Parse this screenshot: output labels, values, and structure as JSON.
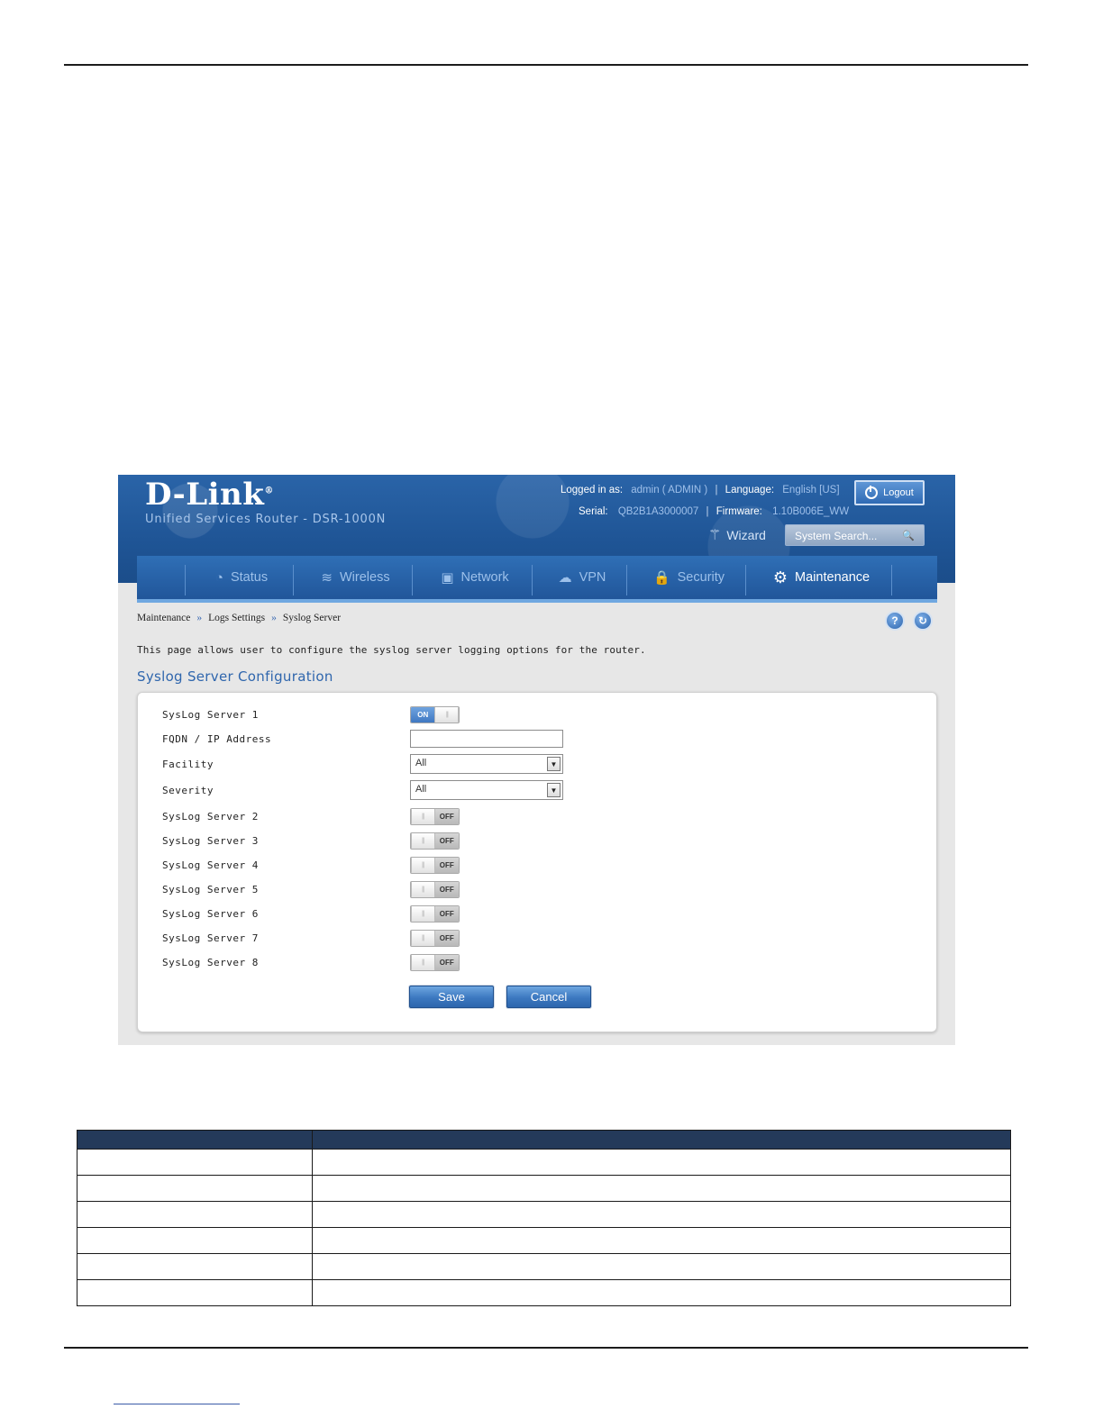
{
  "header": {
    "logo": "D-Link",
    "subtitle": "Unified Services Router - DSR-1000N",
    "logged_in_label": "Logged in as:",
    "logged_in_value": "admin ( ADMIN )",
    "language_label": "Language:",
    "language_value": "English [US]",
    "serial_label": "Serial:",
    "serial_value": "QB2B1A3000007",
    "firmware_label": "Firmware:",
    "firmware_value": "1.10B006E_WW",
    "logout_label": "Logout",
    "wizard_label": "Wizard",
    "search_placeholder": "System Search..."
  },
  "nav": [
    {
      "label": "Status",
      "icon": "gauge-icon",
      "active": false
    },
    {
      "label": "Wireless",
      "icon": "wifi-icon",
      "active": false
    },
    {
      "label": "Network",
      "icon": "computer-icon",
      "active": false
    },
    {
      "label": "VPN",
      "icon": "cloud-icon",
      "active": false
    },
    {
      "label": "Security",
      "icon": "lock-icon",
      "active": false
    },
    {
      "label": "Maintenance",
      "icon": "gears-icon",
      "active": true
    }
  ],
  "breadcrumb": {
    "items": [
      "Maintenance",
      "Logs Settings",
      "Syslog Server"
    ],
    "separator": "»"
  },
  "help_icon_label": "?",
  "description": "This page allows user to configure the syslog server logging options for the router.",
  "section_title": "Syslog Server Configuration",
  "form": {
    "server1": {
      "label": "SysLog Server 1",
      "state": "ON"
    },
    "fqdn": {
      "label": "FQDN / IP Address",
      "value": ""
    },
    "facility": {
      "label": "Facility",
      "value": "All"
    },
    "severity": {
      "label": "Severity",
      "value": "All"
    },
    "servers": [
      {
        "label": "SysLog Server 2",
        "state": "OFF"
      },
      {
        "label": "SysLog Server 3",
        "state": "OFF"
      },
      {
        "label": "SysLog Server 4",
        "state": "OFF"
      },
      {
        "label": "SysLog Server 5",
        "state": "OFF"
      },
      {
        "label": "SysLog Server 6",
        "state": "OFF"
      },
      {
        "label": "SysLog Server 7",
        "state": "OFF"
      },
      {
        "label": "SysLog Server 8",
        "state": "OFF"
      }
    ],
    "save_label": "Save",
    "cancel_label": "Cancel"
  },
  "colors": {
    "header_blue": "#1f5596",
    "accent_link": "#2f66ad",
    "table_header": "#243a5a"
  }
}
